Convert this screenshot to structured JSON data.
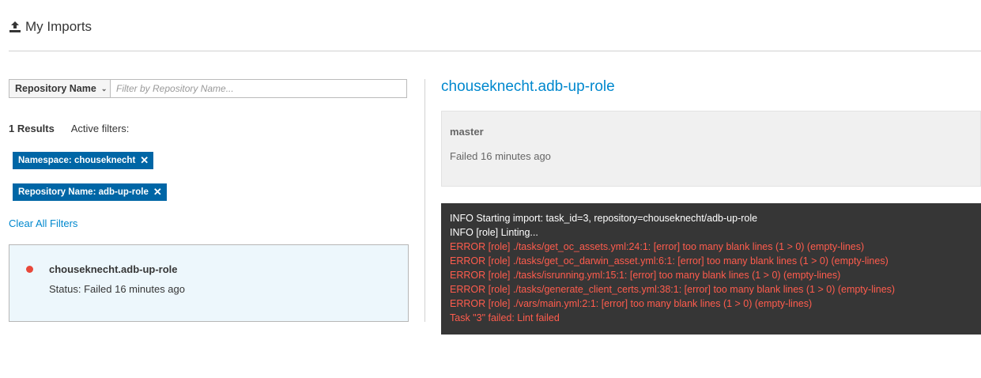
{
  "header": {
    "title": "My Imports",
    "icon": "upload-icon"
  },
  "filter": {
    "field_label": "Repository Name",
    "placeholder": "Filter by Repository Name...",
    "value": ""
  },
  "results": {
    "count_label": "1 Results",
    "active_filters_label": "Active filters:",
    "chips": [
      {
        "label": "Namespace: chouseknecht"
      },
      {
        "label": "Repository Name: adb-up-role"
      }
    ],
    "clear_label": "Clear All Filters"
  },
  "imports": [
    {
      "name": "chouseknecht.adb-up-role",
      "status": "Status: Failed 16 minutes ago",
      "state_color": "#e8483a"
    }
  ],
  "detail": {
    "title": "chouseknecht.adb-up-role",
    "branch": "master",
    "when": "Failed 16 minutes ago",
    "log": [
      {
        "level": "info",
        "text": "INFO Starting import: task_id=3, repository=chouseknecht/adb-up-role"
      },
      {
        "level": "info",
        "text": "INFO [role] Linting..."
      },
      {
        "level": "error",
        "text": "ERROR [role] ./tasks/get_oc_assets.yml:24:1: [error] too many blank lines (1 > 0) (empty-lines)"
      },
      {
        "level": "error",
        "text": "ERROR [role] ./tasks/get_oc_darwin_asset.yml:6:1: [error] too many blank lines (1 > 0) (empty-lines)"
      },
      {
        "level": "error",
        "text": "ERROR [role] ./tasks/isrunning.yml:15:1: [error] too many blank lines (1 > 0) (empty-lines)"
      },
      {
        "level": "error",
        "text": "ERROR [role] ./tasks/generate_client_certs.yml:38:1: [error] too many blank lines (1 > 0) (empty-lines)"
      },
      {
        "level": "error",
        "text": "ERROR [role] ./vars/main.yml:2:1: [error] too many blank lines (1 > 0) (empty-lines)"
      },
      {
        "level": "error",
        "text": "Task \"3\" failed: Lint failed"
      }
    ]
  },
  "colors": {
    "link": "#0088ce",
    "chip": "#0066a6",
    "error": "#ff5c4d",
    "log_bg": "#363636"
  }
}
